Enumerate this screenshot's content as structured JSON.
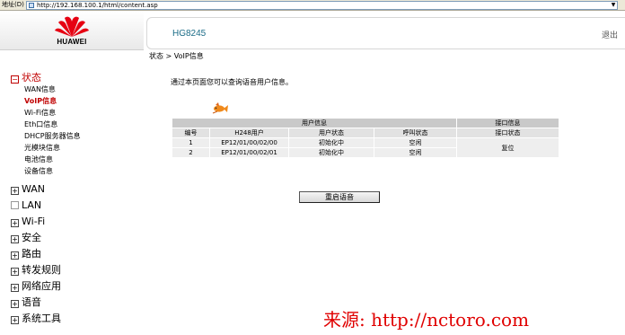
{
  "browser": {
    "address_label": "地址(D)",
    "url": "http://192.168.100.1/html/content.asp"
  },
  "logo": {
    "text": "HUAWEI",
    "color": "#e60012"
  },
  "header": {
    "device_name": "HG8245",
    "logout_label": "退出"
  },
  "sidebar": {
    "groups": [
      {
        "label": "状态",
        "expanded": true,
        "active": true
      },
      {
        "label": "WAN"
      },
      {
        "label": "LAN"
      },
      {
        "label": "Wi-Fi"
      },
      {
        "label": "安全"
      },
      {
        "label": "路由"
      },
      {
        "label": "转发规则"
      },
      {
        "label": "网络应用"
      },
      {
        "label": "语音"
      },
      {
        "label": "系统工具"
      }
    ],
    "status_items": [
      {
        "label": "WAN信息"
      },
      {
        "label": "VoIP信息",
        "active": true
      },
      {
        "label": "Wi-Fi信息"
      },
      {
        "label": "Eth口信息"
      },
      {
        "label": "DHCP服务器信息"
      },
      {
        "label": "光模块信息"
      },
      {
        "label": "电池信息"
      },
      {
        "label": "设备信息"
      }
    ]
  },
  "breadcrumb": "状态 > VoIP信息",
  "intro_text": "通过本页面您可以查询语音用户信息。",
  "table": {
    "group_user": "用户信息",
    "group_port": "接口信息",
    "columns": [
      "编号",
      "H248用户",
      "用户状态",
      "呼叫状态",
      "接口状态"
    ],
    "rows": [
      {
        "id": "1",
        "user": "EP12/01/00/02/00",
        "user_status": "初始化中",
        "call_status": "空闲"
      },
      {
        "id": "2",
        "user": "EP12/01/00/02/01",
        "user_status": "初始化中",
        "call_status": "空闲"
      }
    ],
    "port_status": "复位"
  },
  "restart_button": "重启语音",
  "watermark": "来源: http://nctoro.com",
  "colors": {
    "accent_red": "#c00000",
    "device_blue": "#1b6c87",
    "watermark_red": "#e00000"
  }
}
